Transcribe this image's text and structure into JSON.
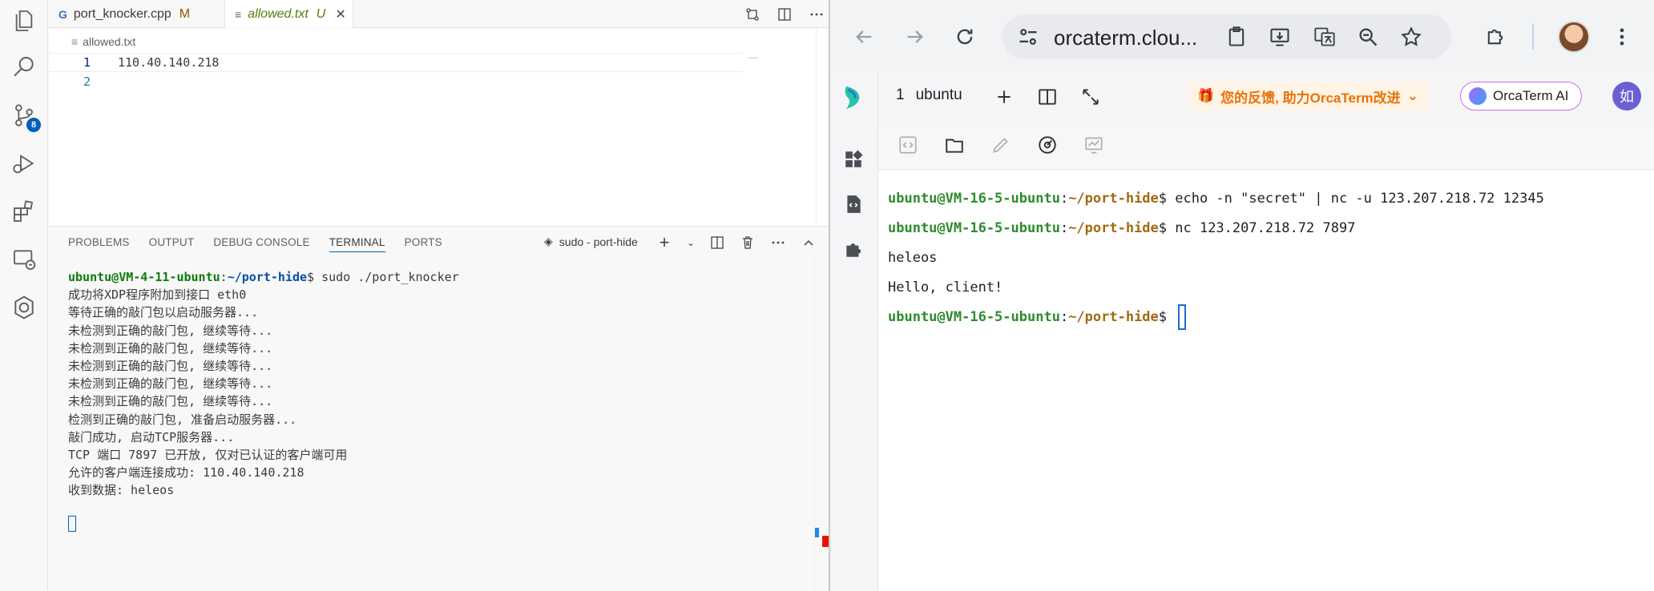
{
  "vscode": {
    "tabs": [
      {
        "icon": "G",
        "name": "port_knocker.cpp",
        "status": "M"
      },
      {
        "icon": "≡",
        "name": "allowed.txt",
        "status": "U"
      }
    ],
    "badge": "8",
    "breadcrumb": "allowed.txt",
    "editor_lines": [
      {
        "num": "1",
        "text": "110.40.140.218"
      },
      {
        "num": "2",
        "text": ""
      }
    ],
    "editor_more": "....",
    "panel_tabs": [
      "PROBLEMS",
      "OUTPUT",
      "DEBUG CONSOLE",
      "TERMINAL",
      "PORTS"
    ],
    "terminal_name": "sudo - port-hide",
    "terminal": {
      "prompt_user": "ubuntu@VM-4-11-ubuntu",
      "prompt_sep": ":",
      "prompt_path": "~/port-hide",
      "prompt_cmd": "$ sudo ./port_knocker",
      "output": [
        "成功将XDP程序附加到接口 eth0",
        "等待正确的敲门包以启动服务器...",
        "未检测到正确的敲门包, 继续等待...",
        "未检测到正确的敲门包, 继续等待...",
        "未检测到正确的敲门包, 继续等待...",
        "未检测到正确的敲门包, 继续等待...",
        "未检测到正确的敲门包, 继续等待...",
        "检测到正确的敲门包, 准备启动服务器...",
        "敲门成功, 启动TCP服务器...",
        "TCP 端口 7897 已开放, 仅对已认证的客户端可用",
        "允许的客户端连接成功: 110.40.140.218",
        "收到数据: heleos"
      ]
    }
  },
  "browser": {
    "url": "orcaterm.clou...",
    "session_tab": {
      "num": "1",
      "name": "ubuntu"
    },
    "feedback": "您的反馈, 助力OrcaTerm改进",
    "orca_ai": "OrcaTerm AI",
    "user_avatar": "如",
    "terminal": {
      "lines": [
        {
          "user": "ubuntu@VM-16-5-ubuntu",
          "sep": ":",
          "path": "~/port-hide",
          "cmd": "$ echo -n \"secret\" | nc -u 123.207.218.72 12345"
        },
        {
          "user": "ubuntu@VM-16-5-ubuntu",
          "sep": ":",
          "path": "~/port-hide",
          "cmd": "$ nc 123.207.218.72 7897"
        },
        {
          "text": "heleos"
        },
        {
          "text": "Hello, client!"
        },
        {
          "user": "ubuntu@VM-16-5-ubuntu",
          "sep": ":",
          "path": "~/port-hide",
          "cmd": "$ "
        }
      ]
    }
  }
}
